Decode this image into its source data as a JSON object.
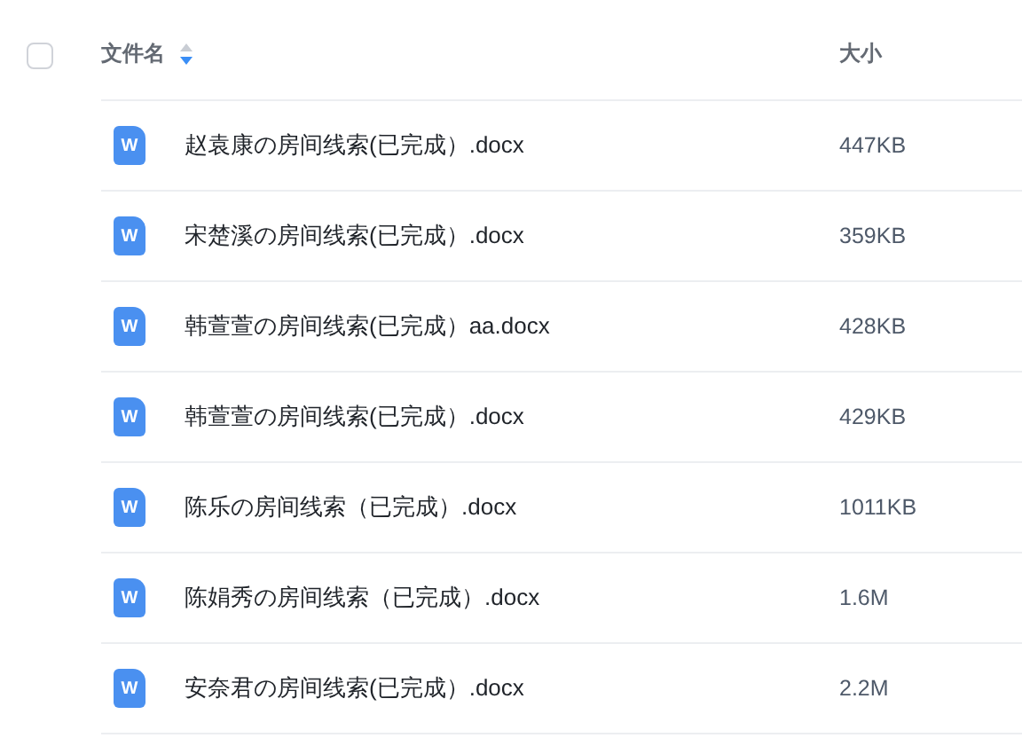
{
  "header": {
    "select_all_checked": false,
    "columns": [
      {
        "label": "文件名",
        "sorted": true,
        "descending": true
      },
      {
        "label": "大小",
        "sorted": false
      }
    ]
  },
  "files": [
    {
      "icon": "W",
      "name": "赵袁康の房间线索(已完成）.docx",
      "size": "447KB"
    },
    {
      "icon": "W",
      "name": "宋楚溪の房间线索(已完成）.docx",
      "size": "359KB"
    },
    {
      "icon": "W",
      "name": "韩萱萱の房间线索(已完成）aa.docx",
      "size": "428KB"
    },
    {
      "icon": "W",
      "name": "韩萱萱の房间线索(已完成）.docx",
      "size": "429KB"
    },
    {
      "icon": "W",
      "name": "陈乐の房间线索（已完成）.docx",
      "size": "1011KB"
    },
    {
      "icon": "W",
      "name": "陈娟秀の房间线索（已完成）.docx",
      "size": "1.6M"
    },
    {
      "icon": "W",
      "name": "安奈君の房间线索(已完成）.docx",
      "size": "2.2M"
    }
  ]
}
